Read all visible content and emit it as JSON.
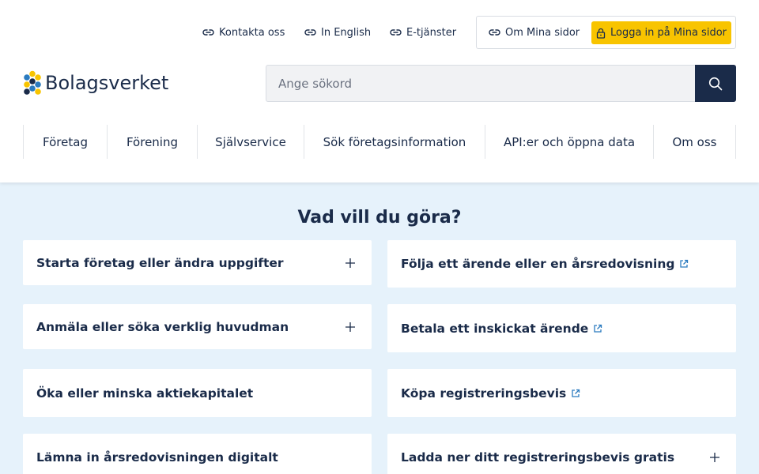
{
  "utility_nav": {
    "contact": "Kontakta oss",
    "english": "In English",
    "etjanster": "E-tjänster",
    "om_mina_sidor": "Om Mina sidor",
    "login": "Logga in på Mina sidor"
  },
  "logo": {
    "text": "Bolagsverket"
  },
  "search": {
    "placeholder": "Ange sökord"
  },
  "main_nav": {
    "items": [
      {
        "label": "Företag"
      },
      {
        "label": "Förening"
      },
      {
        "label": "Självservice"
      },
      {
        "label": "Sök företagsinformation"
      },
      {
        "label": "API:er och öppna data"
      },
      {
        "label": "Om oss"
      }
    ]
  },
  "section": {
    "title": "Vad vill du göra?",
    "cards": [
      {
        "label": "Starta företag eller ändra uppgifter"
      },
      {
        "label": "Följa ett ärende eller en årsredovisning"
      },
      {
        "label": "Anmäla eller söka verklig huvudman"
      },
      {
        "label": "Betala ett inskickat ärende"
      },
      {
        "label": "Öka eller minska aktiekapitalet"
      },
      {
        "label": "Köpa registreringsbevis"
      },
      {
        "label": "Lämna in årsredovisningen digitalt"
      },
      {
        "label": "Ladda ner ditt registreringsbevis gratis"
      }
    ]
  },
  "colors": {
    "navy": "#1a2b49",
    "yellow": "#f8c400",
    "light_blue_bg": "#e6f2fb",
    "logo_blue": "#2b7bbf",
    "logo_yellow": "#f8c400"
  },
  "icons": {
    "link": "link-icon",
    "lock": "lock-icon",
    "search": "search-icon",
    "external": "external-link-icon",
    "plus": "plus-icon"
  }
}
